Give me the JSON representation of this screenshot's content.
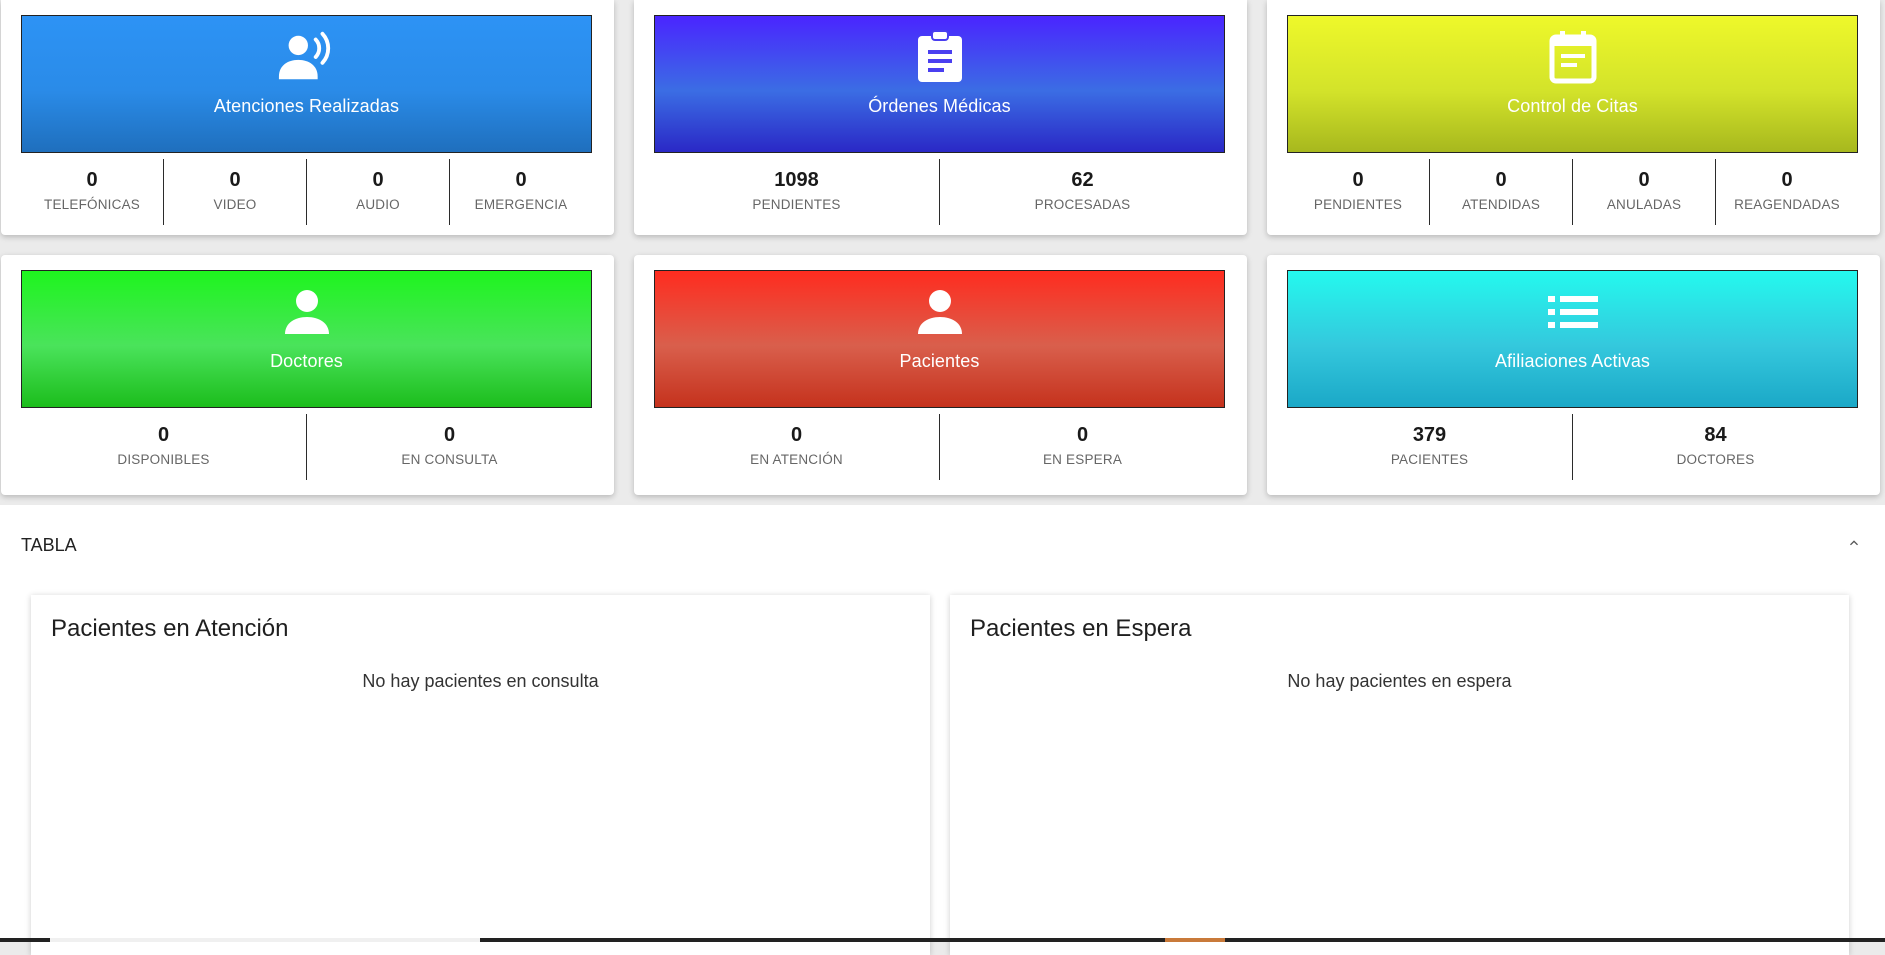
{
  "cards": [
    {
      "title": "Atenciones Realizadas",
      "icon": "call-agent-icon",
      "gradient": [
        "#2d93f5",
        "#2a8be8",
        "#1f6fbd"
      ],
      "stats": [
        {
          "value": "0",
          "label": "TELEFÓNICAS"
        },
        {
          "value": "0",
          "label": "VIDEO"
        },
        {
          "value": "0",
          "label": "AUDIO"
        },
        {
          "value": "0",
          "label": "EMERGENCIA"
        }
      ]
    },
    {
      "title": "Órdenes Médicas",
      "icon": "clipboard-icon",
      "gradient": [
        "#4a25ff",
        "#3b6de4",
        "#2a28c6"
      ],
      "stats": [
        {
          "value": "1098",
          "label": "PENDIENTES"
        },
        {
          "value": "62",
          "label": "PROCESADAS"
        }
      ]
    },
    {
      "title": "Control de Citas",
      "icon": "calendar-icon",
      "gradient": [
        "#eef82a",
        "#d3e32a",
        "#a7b81e"
      ],
      "stats": [
        {
          "value": "0",
          "label": "PENDIENTES"
        },
        {
          "value": "0",
          "label": "ATENDIDAS"
        },
        {
          "value": "0",
          "label": "ANULADAS"
        },
        {
          "value": "0",
          "label": "REAGENDADAS"
        }
      ]
    },
    {
      "title": "Doctores",
      "icon": "person-icon",
      "gradient": [
        "#1ef51e",
        "#4ae35b",
        "#1cbd1c"
      ],
      "stats": [
        {
          "value": "0",
          "label": "DISPONIBLES"
        },
        {
          "value": "0",
          "label": "EN CONSULTA"
        }
      ]
    },
    {
      "title": "Pacientes",
      "icon": "person-icon",
      "gradient": [
        "#ff2c1f",
        "#d95f4c",
        "#c5321d"
      ],
      "stats": [
        {
          "value": "0",
          "label": "EN ATENCIÓN"
        },
        {
          "value": "0",
          "label": "EN ESPERA"
        }
      ]
    },
    {
      "title": "Afiliaciones Activas",
      "icon": "list-icon",
      "gradient": [
        "#24f9ee",
        "#34c8dd",
        "#1ba8c7"
      ],
      "stats": [
        {
          "value": "379",
          "label": "PACIENTES"
        },
        {
          "value": "84",
          "label": "DOCTORES"
        }
      ]
    }
  ],
  "tabla": {
    "title": "TABLA",
    "panels": [
      {
        "title": "Pacientes en Atención",
        "empty_text": "No hay pacientes en consulta"
      },
      {
        "title": "Pacientes en Espera",
        "empty_text": "No hay pacientes en espera"
      }
    ]
  }
}
